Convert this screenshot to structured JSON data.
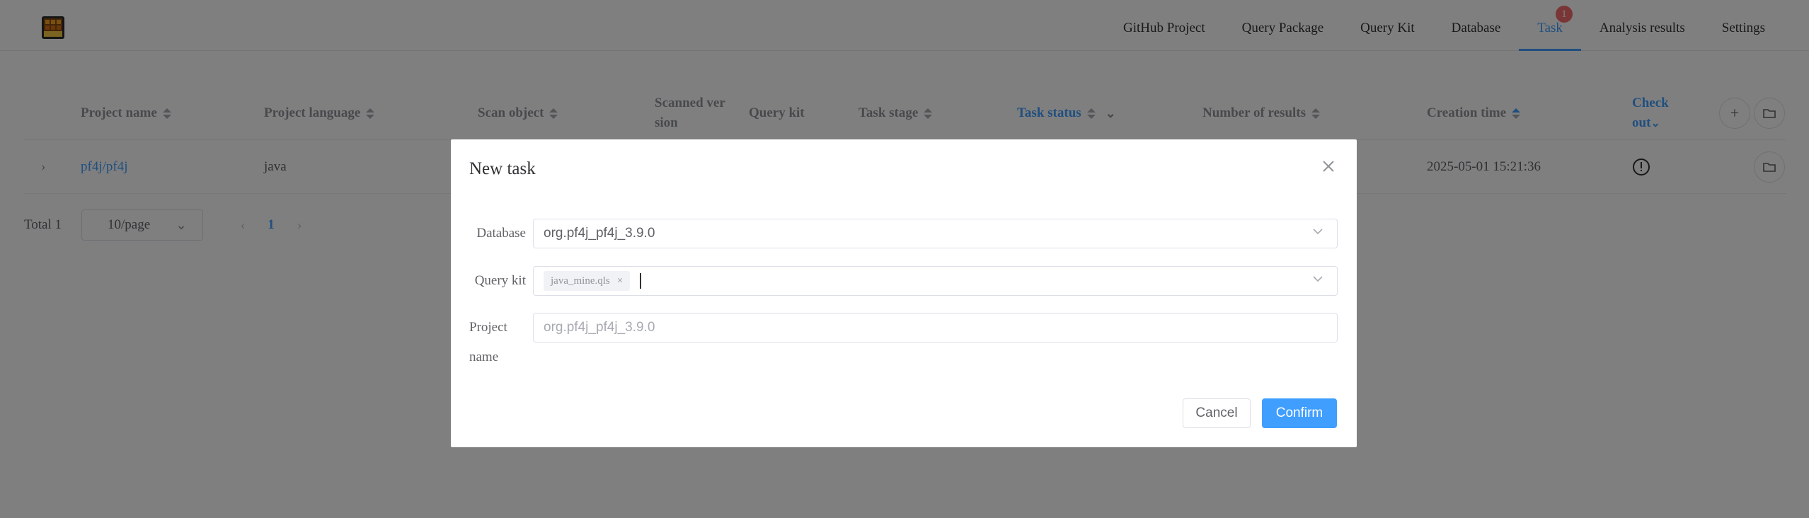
{
  "header": {
    "nav": [
      {
        "label": "GitHub Project"
      },
      {
        "label": "Query Package"
      },
      {
        "label": "Query Kit"
      },
      {
        "label": "Database"
      },
      {
        "label": "Task",
        "badge": "1",
        "active": true
      },
      {
        "label": "Analysis results"
      },
      {
        "label": "Settings"
      }
    ]
  },
  "table": {
    "columns": {
      "project_name": "Project name",
      "project_language": "Project language",
      "scan_object": "Scan object",
      "scanned_version_1": "Scanned ver",
      "scanned_version_2": "sion",
      "query_kit": "Query kit",
      "task_stage": "Task stage",
      "task_status": "Task status",
      "number_of_results": "Number of results",
      "creation_time": "Creation time",
      "check_out_1": "Check",
      "check_out_2": "out"
    },
    "rows": [
      {
        "project_name": "pf4j/pf4j",
        "project_language": "java",
        "creation_time": "2025-05-01 15:21:36"
      }
    ]
  },
  "pagination": {
    "total": "Total 1",
    "page_size": "10/page",
    "current_page": "1"
  },
  "dialog": {
    "title": "New task",
    "database_label": "Database",
    "database_value": "org.pf4j_pf4j_3.9.0",
    "query_kit_label": "Query kit",
    "query_kit_tag": "java_mine.qls",
    "project_label_1": "Project",
    "project_label_2": "name",
    "project_placeholder": "org.pf4j_pf4j_3.9.0",
    "cancel": "Cancel",
    "confirm": "Confirm"
  },
  "colors": {
    "accent": "#409eff",
    "badge": "#f56c6c",
    "overlay": "rgba(0,0,0,0.5)"
  },
  "icons": [
    "logo-icon",
    "sort-icon",
    "chevron-down-icon",
    "plus-icon",
    "folder-icon",
    "expand-arrow-icon",
    "info-icon",
    "close-icon",
    "tag-remove-icon",
    "arrow-left-icon",
    "arrow-right-icon"
  ]
}
